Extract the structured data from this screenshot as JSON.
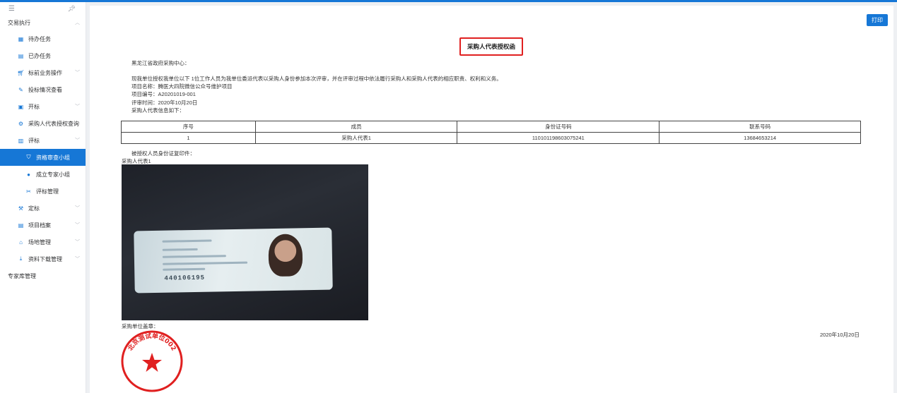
{
  "sidebar": {
    "menu_icon": "menu-icon",
    "pin_icon": "pin-icon",
    "section_title": "交易执行",
    "items": [
      {
        "label": "待办任务",
        "icon": "todo-icon"
      },
      {
        "label": "已办任务",
        "icon": "done-icon"
      },
      {
        "label": "标前业务操作",
        "icon": "cart-icon",
        "caret": true
      },
      {
        "label": "投标情况查看",
        "icon": "edit-icon"
      },
      {
        "label": "开标",
        "icon": "open-bid-icon",
        "caret": true
      },
      {
        "label": "采购人代表授权查询",
        "icon": "gear-icon"
      },
      {
        "label": "评标",
        "icon": "evaluate-icon",
        "caret": true
      }
    ],
    "sub_items": [
      {
        "label": "资格审查小组",
        "icon": "shield-icon",
        "active": true
      },
      {
        "label": "成立专家小组",
        "icon": "user-icon"
      },
      {
        "label": "评标管理",
        "icon": "tools-icon"
      }
    ],
    "items2": [
      {
        "label": "定标",
        "icon": "gavel-icon",
        "caret": true
      },
      {
        "label": "项目档案",
        "icon": "folder-icon",
        "caret": true
      },
      {
        "label": "场地管理",
        "icon": "venue-icon",
        "caret": true
      },
      {
        "label": "资料下载管理",
        "icon": "download-icon",
        "caret": true
      }
    ],
    "bottom_item": "专家库管理"
  },
  "toolbar": {
    "print_label": "打印"
  },
  "document": {
    "title": "采购人代表授权函",
    "recipient": "黑龙江省政府采购中心：",
    "body": "现我单位授权我单位以下 1位工作人员为我单位委派代表以采购人身份参加本次评审，并在评审过程中依法履行采购人和采购人代表的相应职责、权利和义务。",
    "project_name": "项目名称：腾医大四院微信公众号维护项目",
    "project_no": "项目编号：A20201019-001",
    "review_time": "评审时间：2020年10月20日",
    "rep_info": "采购人代表信息如下：",
    "table": {
      "headers": [
        "序号",
        "成员",
        "身份证号码",
        "联系号码"
      ],
      "rows": [
        [
          "1",
          "采购人代表1",
          "110101198603075241",
          "13684653214"
        ]
      ]
    },
    "id_copy_label": "被授权人员身份证复印件：",
    "rep_name": "采购人代表1",
    "id_number_fragment": "440106195",
    "seal_label": "采购单位盖章：",
    "date": "2020年10月20日",
    "stamp_text": "北京测试单位002"
  },
  "colors": {
    "accent": "#1677d6",
    "stamp": "#e02020"
  }
}
